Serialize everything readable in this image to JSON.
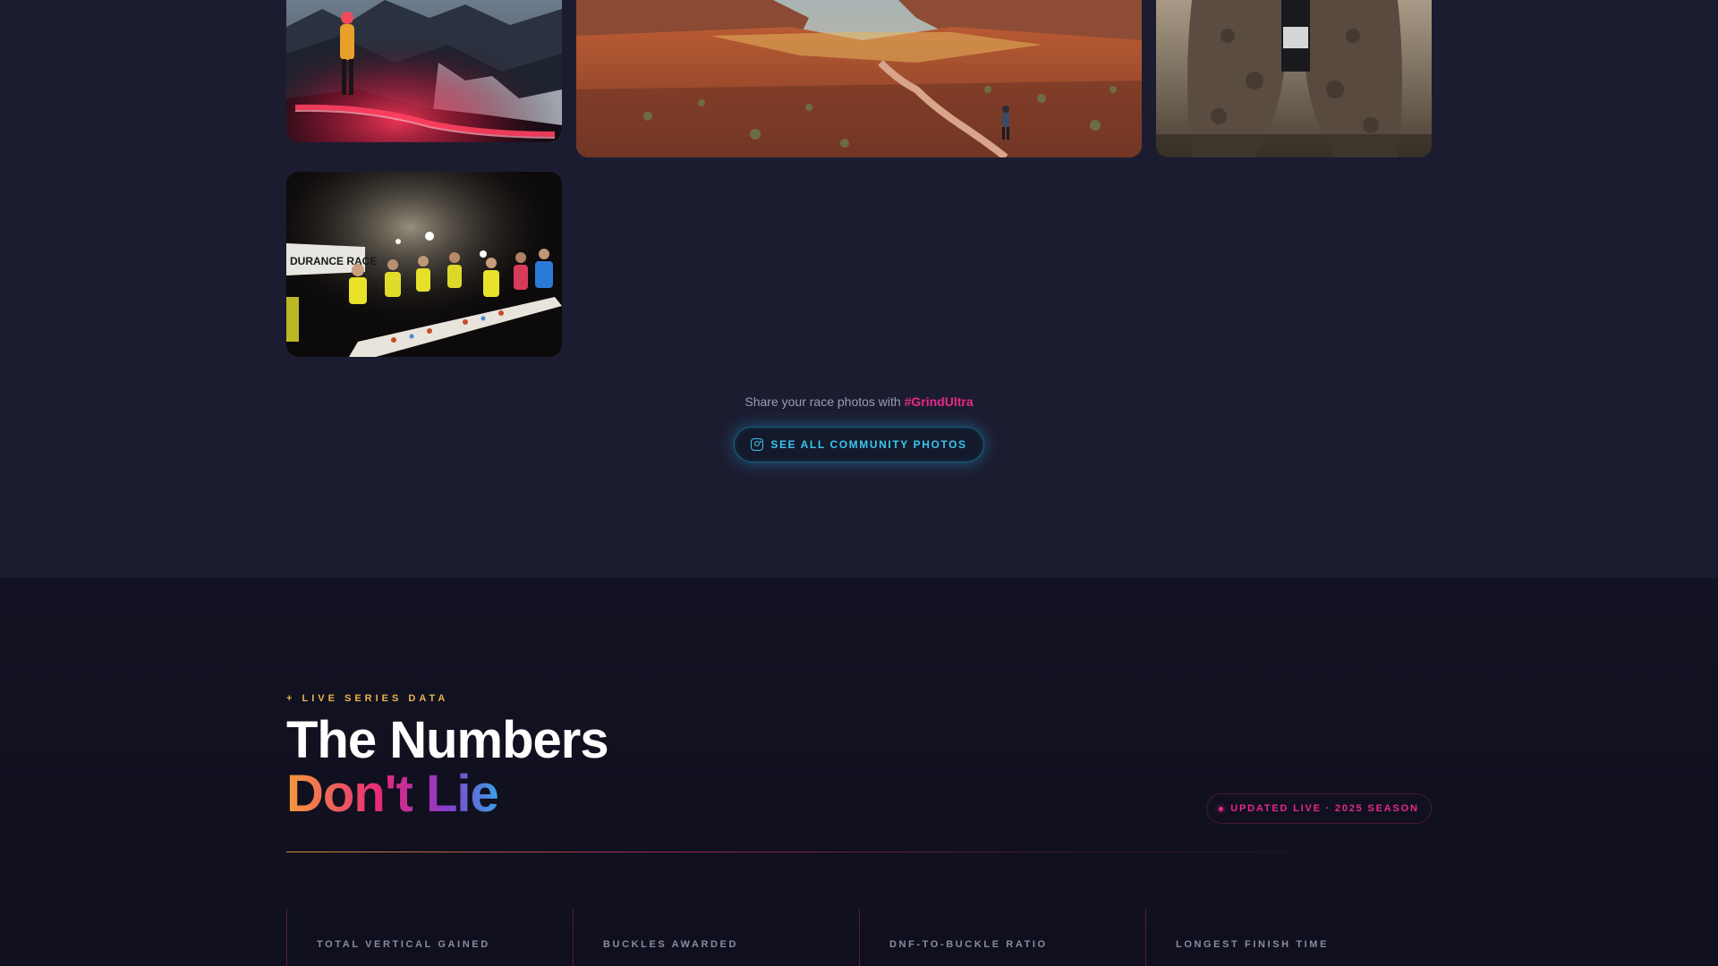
{
  "gallery": {
    "photos": [
      {
        "name": "mountain-night-photo"
      },
      {
        "name": "canyon-trail-photo"
      },
      {
        "name": "muddy-legs-photo"
      },
      {
        "name": "aid-station-photo",
        "banner_text": "DURANCE RACE"
      }
    ],
    "share_text": "Share your race photos with ",
    "hashtag": "#GrindUltra",
    "cta_icon": "instagram-icon",
    "cta_label": "SEE ALL COMMUNITY PHOTOS"
  },
  "numbers": {
    "eyebrow": "+ LIVE SERIES DATA",
    "title_line1": "The Numbers",
    "title_line2": "Don't Lie",
    "live_badge": "UPDATED LIVE · 2025 SEASON",
    "stats": [
      {
        "label": "TOTAL VERTICAL GAINED"
      },
      {
        "label": "BUCKLES AWARDED"
      },
      {
        "label": "DNF-TO-BUCKLE RATIO"
      },
      {
        "label": "LONGEST FINISH TIME"
      }
    ]
  },
  "colors": {
    "accent_pink": "#e8288a",
    "accent_cyan": "#3bc5f0",
    "accent_gold": "#e9b44c",
    "bg_top": "#1c1c30",
    "bg_bottom": "#121222"
  }
}
